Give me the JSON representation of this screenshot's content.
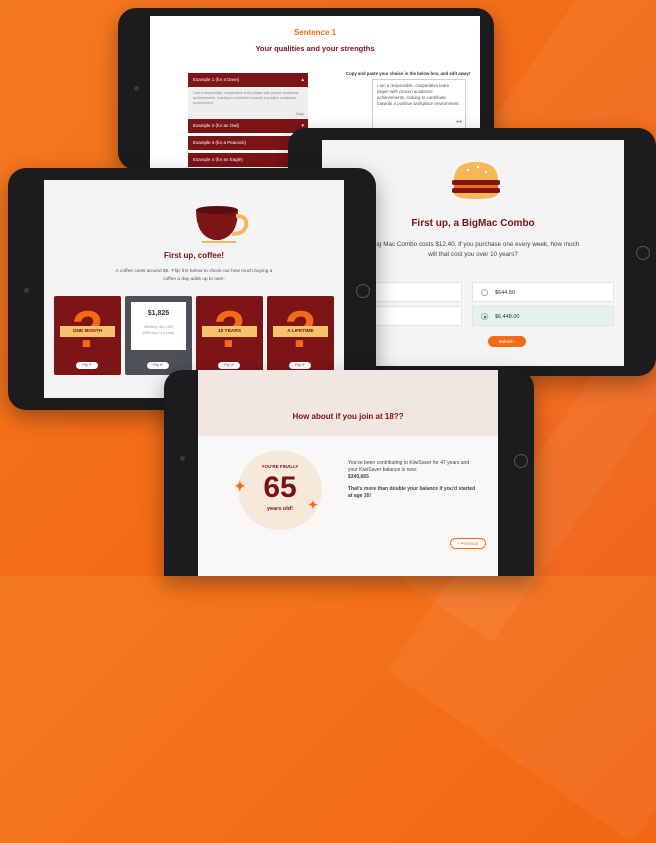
{
  "sentence_screen": {
    "heading": "Sentence 1",
    "subheading": "Your qualities and your strengths",
    "examples": [
      {
        "label": "Example 1 (for a Dove)"
      },
      {
        "label": "Example 2 (for an Owl)"
      },
      {
        "label": "Example 3 (for a Peacock)"
      },
      {
        "label": "Example 4 (for an Eagle)"
      }
    ],
    "example_body": "I am a responsible, cooperative team player with proven academic achievements, looking to contribute towards a positive workplace environment.",
    "copy_label": "Copy",
    "instruction": "Copy and paste your choice in the below box, and edit away!",
    "textbox_value": "I am a responsible, cooperative team player with proven academic achievements, looking to contribute towards a positive workplace environment."
  },
  "bigmac_screen": {
    "title": "First up, a BigMac Combo",
    "question": "A Big Mac Combo costs $12.40. If you purchase one every week, how much will that cost you over 10 years?",
    "options": [
      {
        "label": "$644.80",
        "selected": false
      },
      {
        "label": "$6,448.00",
        "selected": true
      }
    ],
    "submit_label": "Submit"
  },
  "coffee_screen": {
    "title": "First up, coffee!",
    "description": "A coffee costs around $5. 'Flip' the below to check out how much buying a coffee a day adds up to over:",
    "cards": [
      {
        "label": "ONE MONTH",
        "flipped": false
      },
      {
        "amount": "$1,825",
        "working": "Working: $5 x 365",
        "note": "(365 days in a year)",
        "flipped": true
      },
      {
        "label": "10 YEARS",
        "flipped": false
      },
      {
        "label": "A LIFETIME",
        "flipped": false
      }
    ],
    "flip_label": "Flip"
  },
  "kiwisaver_screen": {
    "title": "How about if you join at 18??",
    "badge_top": "YOU'RE FINALLY",
    "badge_number": "65",
    "badge_bottom": "years old!",
    "line1": "You've been contributing to KiwiSaver for 47 years and your KiwiSaver balance is now:",
    "balance": "$340,665",
    "line2": "That's more than double your balance if you'd started at age 35!",
    "previous_label": "Previous"
  },
  "colors": {
    "background": "#f36b17",
    "maroon": "#7d1416",
    "orange": "#f36b17",
    "tan": "#f6c26b",
    "teal": "#37a7a3"
  }
}
